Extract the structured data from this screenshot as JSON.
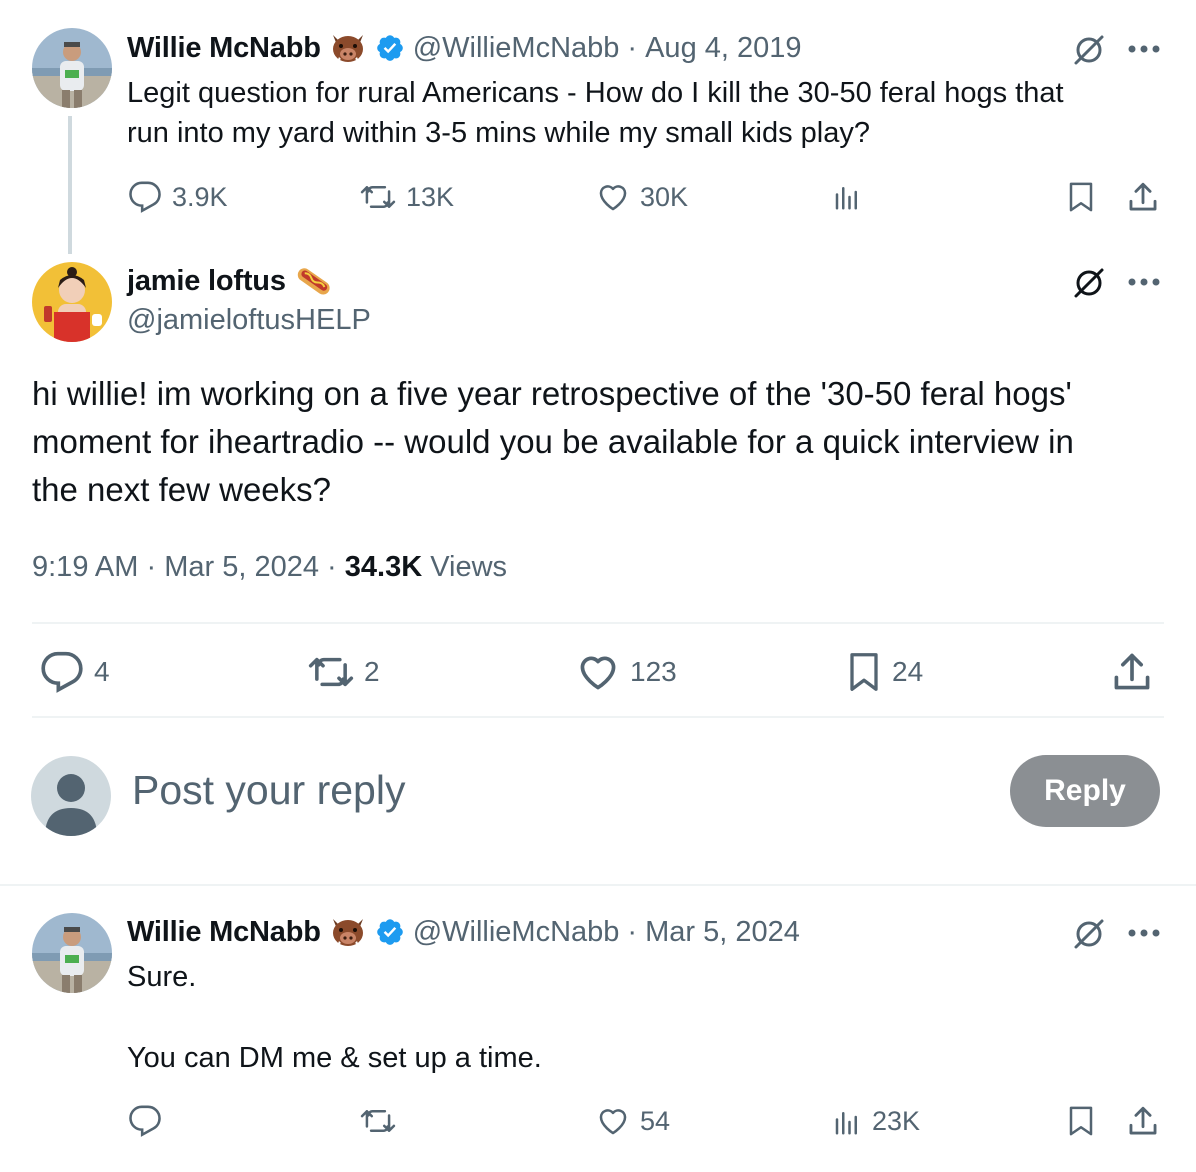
{
  "parent_tweet": {
    "author_name": "Willie McNabb",
    "handle": "@WillieMcNabb",
    "date": "Aug 4, 2019",
    "text_line1": "Legit question for rural Americans - How do I kill the 30-50 feral hogs that",
    "text_line2": "run into my yard within 3-5 mins while my small kids play?",
    "stats": {
      "replies": "3.9K",
      "reposts": "13K",
      "likes": "30K"
    },
    "emoji_icon": "boar-face-icon",
    "verified_color": "#1d9bf0"
  },
  "main_tweet": {
    "author_name": "jamie loftus",
    "handle": "@jamieloftusHELP",
    "emoji_icon": "hotdog-icon",
    "text_line1": "hi willie! im working on a five year retrospective of the '30-50 feral hogs'",
    "text_line2": "moment for iheartradio -- would you be available for a quick interview in",
    "text_line3": "the next few weeks?",
    "time": "9:19 AM",
    "date": "Mar 5, 2024",
    "views_count": "34.3K",
    "views_label": "Views",
    "stats": {
      "replies": "4",
      "reposts": "2",
      "likes": "123",
      "bookmarks": "24"
    }
  },
  "reply_composer": {
    "placeholder": "Post your reply",
    "button_label": "Reply",
    "button_color": "#8b8f93"
  },
  "reply_tweet": {
    "author_name": "Willie McNabb",
    "handle": "@WillieMcNabb",
    "date": "Mar 5, 2024",
    "text_line1": "Sure.",
    "text_line2": "You can DM me & set up a time.",
    "stats": {
      "likes": "54",
      "views": "23K"
    }
  },
  "separator": "·"
}
